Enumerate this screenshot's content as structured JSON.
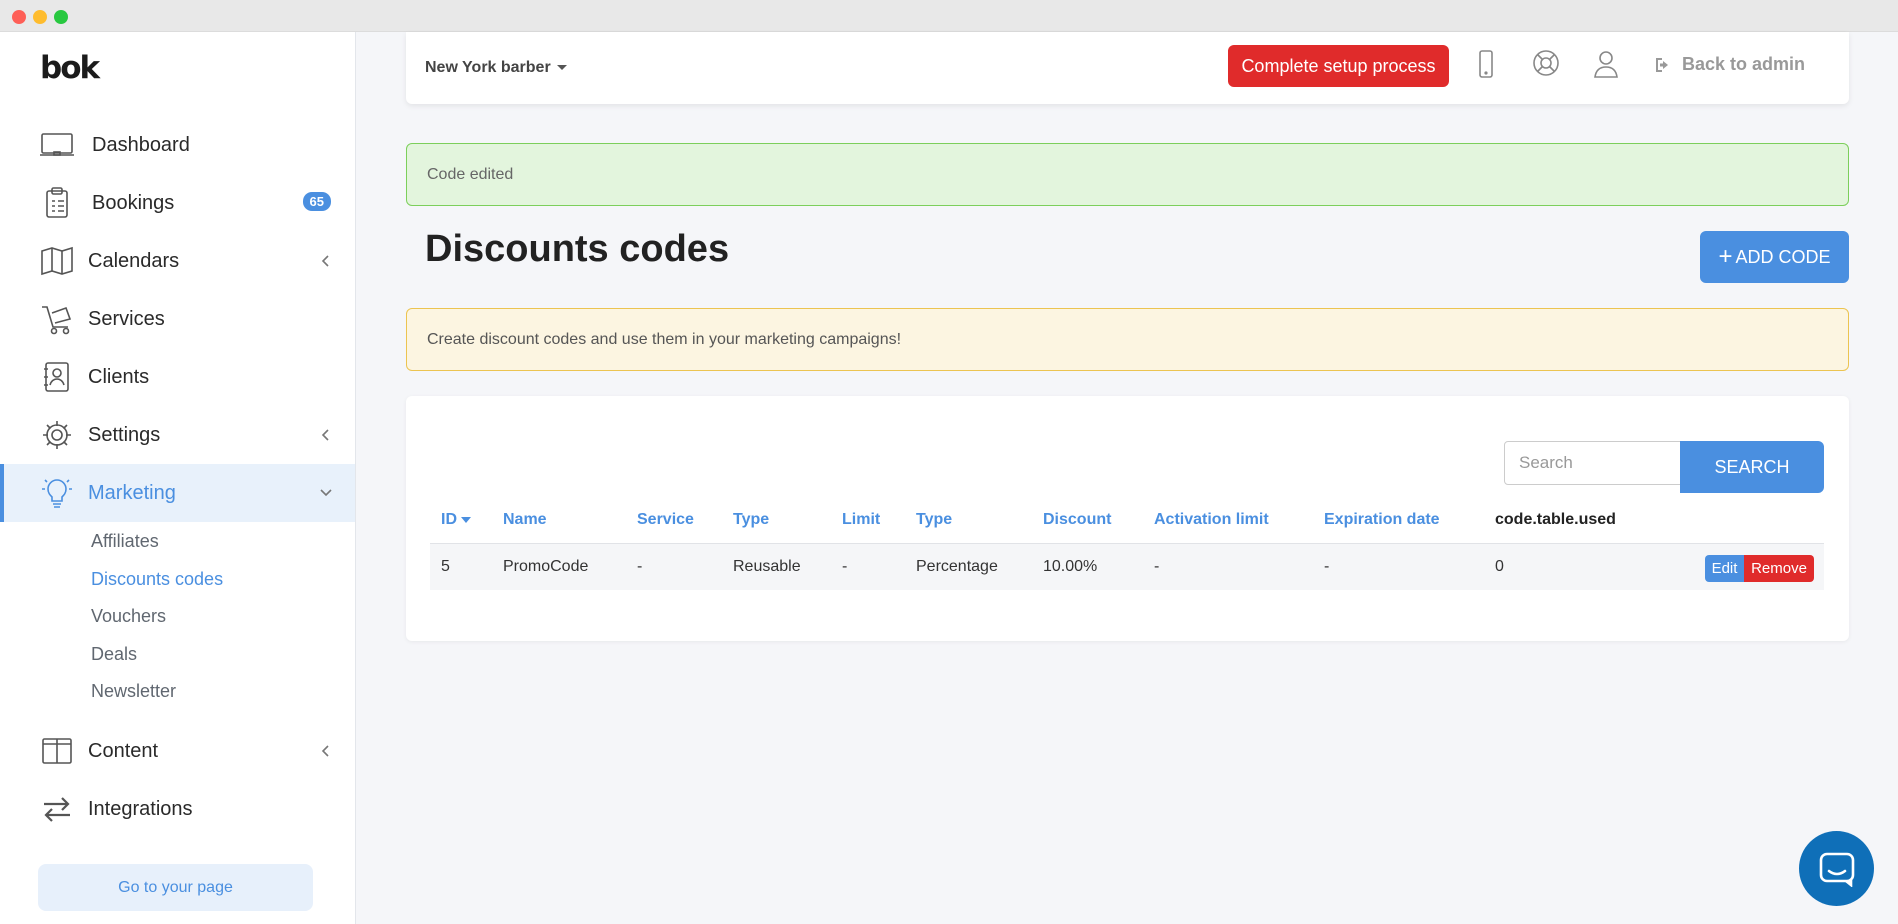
{
  "window": {
    "controls": [
      "close",
      "minimize",
      "maximize"
    ]
  },
  "sidebar": {
    "logo": "bok",
    "items": [
      {
        "label": "Dashboard",
        "icon": "monitor-icon"
      },
      {
        "label": "Bookings",
        "icon": "clipboard-icon",
        "badge": "65"
      },
      {
        "label": "Calendars",
        "icon": "map-icon"
      },
      {
        "label": "Services",
        "icon": "cart-icon"
      },
      {
        "label": "Clients",
        "icon": "contact-card-icon"
      },
      {
        "label": "Settings",
        "icon": "gear-icon"
      },
      {
        "label": "Marketing",
        "icon": "lightbulb-icon"
      },
      {
        "label": "Content",
        "icon": "columns-icon"
      },
      {
        "label": "Integrations",
        "icon": "arrows-icon"
      }
    ],
    "marketing_sub": [
      "Affiliates",
      "Discounts codes",
      "Vouchers",
      "Deals",
      "Newsletter"
    ],
    "goto_page": "Go to your page"
  },
  "topbar": {
    "store_name": "New York barber",
    "setup_button": "Complete setup process",
    "back_to_admin": "Back to admin"
  },
  "alerts": {
    "success": "Code edited",
    "info": "Create discount codes and use them in your marketing campaigns!"
  },
  "page": {
    "title": "Discounts codes",
    "add_button": "ADD CODE"
  },
  "search": {
    "placeholder": "Search",
    "button": "SEARCH"
  },
  "table": {
    "headers": [
      "ID",
      "Name",
      "Service",
      "Type",
      "Limit",
      "Type",
      "Discount",
      "Activation limit",
      "Expiration date",
      "code.table.used"
    ],
    "rows": [
      {
        "id": "5",
        "name": "PromoCode",
        "service": "-",
        "type": "Reusable",
        "limit": "-",
        "discount_type": "Percentage",
        "discount": "10.00%",
        "activation_limit": "-",
        "expiration": "-",
        "used": "0"
      }
    ],
    "edit": "Edit",
    "remove": "Remove"
  },
  "colors": {
    "accent": "#4a8fe0",
    "danger": "#e02b2b",
    "success_bg": "#e3f5dd",
    "warning_bg": "#fcf5e1"
  }
}
